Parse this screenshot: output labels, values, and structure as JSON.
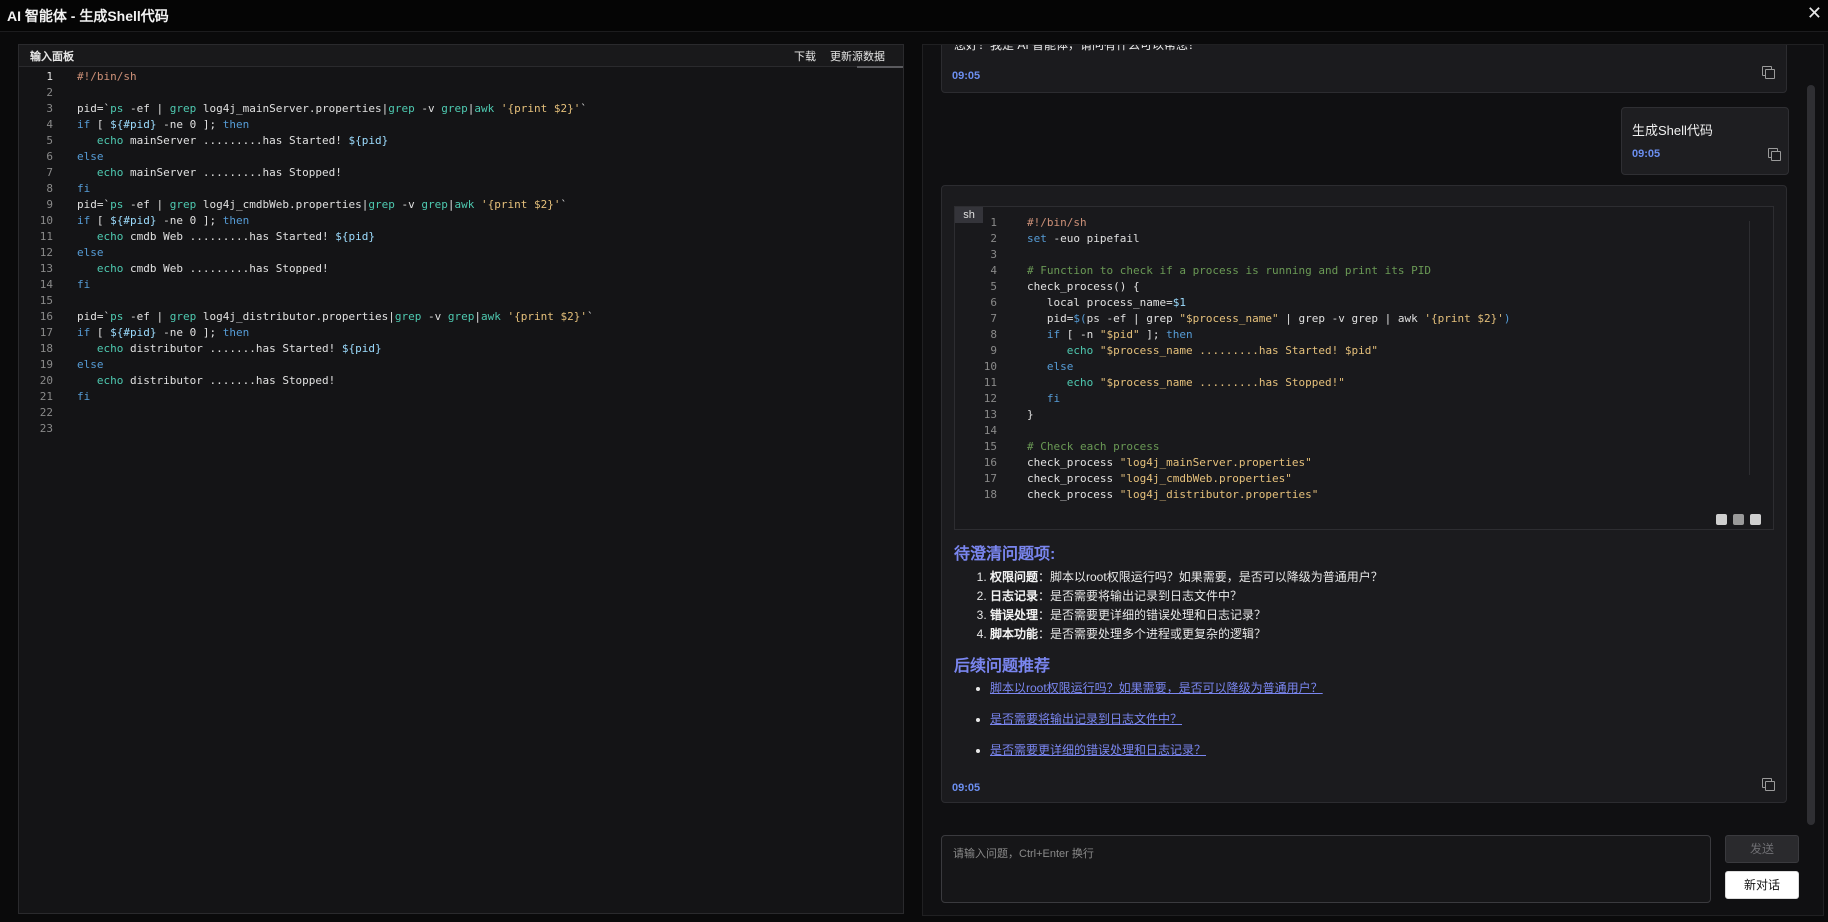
{
  "window": {
    "title": "AI 智能体 - 生成Shell代码",
    "close": "✕"
  },
  "left": {
    "panel_label": "输入面板",
    "download_label": "下载",
    "update_label": "更新源数据",
    "lines": [
      {
        "n": "1",
        "html": "<span class='sh'>#!/bin/sh</span>"
      },
      {
        "n": "2",
        "html": ""
      },
      {
        "n": "3",
        "html": "pid=`<span class='cmd'>ps</span> -ef | <span class='cmd'>grep</span> log4j_mainServer.properties|<span class='cmd'>grep</span> -v <span class='cmd'>grep</span>|<span class='cmd'>awk</span> <span class='str'>'{print $2}'</span>`"
      },
      {
        "n": "4",
        "html": "<span class='kw'>if</span> [ <span class='var'>${#pid}</span> -ne 0 ]; <span class='kw'>then</span>"
      },
      {
        "n": "5",
        "html": "   <span class='cmd'>echo</span> mainServer .........has Started! <span class='var'>${pid}</span>"
      },
      {
        "n": "6",
        "html": "<span class='kw'>else</span>"
      },
      {
        "n": "7",
        "html": "   <span class='cmd'>echo</span> mainServer .........has Stopped!"
      },
      {
        "n": "8",
        "html": "<span class='kw'>fi</span>"
      },
      {
        "n": "9",
        "html": "pid=`<span class='cmd'>ps</span> -ef | <span class='cmd'>grep</span> log4j_cmdbWeb.properties|<span class='cmd'>grep</span> -v <span class='cmd'>grep</span>|<span class='cmd'>awk</span> <span class='str'>'{print $2}'</span>`"
      },
      {
        "n": "10",
        "html": "<span class='kw'>if</span> [ <span class='var'>${#pid}</span> -ne 0 ]; <span class='kw'>then</span>"
      },
      {
        "n": "11",
        "html": "   <span class='cmd'>echo</span> cmdb Web .........has Started! <span class='var'>${pid}</span>"
      },
      {
        "n": "12",
        "html": "<span class='kw'>else</span>"
      },
      {
        "n": "13",
        "html": "   <span class='cmd'>echo</span> cmdb Web .........has Stopped!"
      },
      {
        "n": "14",
        "html": "<span class='kw'>fi</span>"
      },
      {
        "n": "15",
        "html": ""
      },
      {
        "n": "16",
        "html": "pid=`<span class='cmd'>ps</span> -ef | <span class='cmd'>grep</span> log4j_distributor.properties|<span class='cmd'>grep</span> -v <span class='cmd'>grep</span>|<span class='cmd'>awk</span> <span class='str'>'{print $2}'</span>`"
      },
      {
        "n": "17",
        "html": "<span class='kw'>if</span> [ <span class='var'>${#pid}</span> -ne 0 ]; <span class='kw'>then</span>"
      },
      {
        "n": "18",
        "html": "   <span class='cmd'>echo</span> distributor .......has Started! <span class='var'>${pid}</span>"
      },
      {
        "n": "19",
        "html": "<span class='kw'>else</span>"
      },
      {
        "n": "20",
        "html": "   <span class='cmd'>echo</span> distributor .......has Stopped!"
      },
      {
        "n": "21",
        "html": "<span class='kw'>fi</span>"
      },
      {
        "n": "22",
        "html": ""
      },
      {
        "n": "23",
        "html": ""
      }
    ]
  },
  "chat": {
    "greeting": "您好！我是 AI 智能体，请问有什么可以帮您？",
    "greeting_time": "09:05",
    "user_msg": "生成Shell代码",
    "user_time": "09:05",
    "code_lang": "sh",
    "code_lines": [
      {
        "n": "1",
        "html": "<span class='sh'>#!/bin/sh</span>"
      },
      {
        "n": "2",
        "html": "<span class='kw'>set</span> -euo pipefail"
      },
      {
        "n": "3",
        "html": ""
      },
      {
        "n": "4",
        "html": "<span class='cmt'># Function to check if a process is running and print its PID</span>"
      },
      {
        "n": "5",
        "html": "check_process() {"
      },
      {
        "n": "6",
        "html": "   local process_name=<span class='var'>$1</span>"
      },
      {
        "n": "7",
        "html": "   pid=<span class='kw'>$(</span>ps -ef | grep <span class='str'>\"$process_name\"</span> | grep -v grep | awk <span class='str'>'{print $2}'</span><span class='kw'>)</span>"
      },
      {
        "n": "8",
        "html": "   <span class='kw'>if</span> [ -n <span class='str'>\"$pid\"</span> ]; <span class='kw'>then</span>"
      },
      {
        "n": "9",
        "html": "      <span class='cmd'>echo</span> <span class='str'>\"$process_name .........has Started! $pid\"</span>"
      },
      {
        "n": "10",
        "html": "   <span class='kw'>else</span>"
      },
      {
        "n": "11",
        "html": "      <span class='cmd'>echo</span> <span class='str'>\"$process_name .........has Stopped!\"</span>"
      },
      {
        "n": "12",
        "html": "   <span class='kw'>fi</span>"
      },
      {
        "n": "13",
        "html": "}"
      },
      {
        "n": "14",
        "html": ""
      },
      {
        "n": "15",
        "html": "<span class='cmt'># Check each process</span>"
      },
      {
        "n": "16",
        "html": "check_process <span class='str'>\"log4j_mainServer.properties\"</span>"
      },
      {
        "n": "17",
        "html": "check_process <span class='str'>\"log4j_cmdbWeb.properties\"</span>"
      },
      {
        "n": "18",
        "html": "check_process <span class='str'>\"log4j_distributor.properties\"</span>"
      }
    ],
    "clarify_title": "待澄清问题项:",
    "clarify_items": [
      {
        "bold": "权限问题",
        "text": "：脚本以root权限运行吗？如果需要，是否可以降级为普通用户？"
      },
      {
        "bold": "日志记录",
        "text": "：是否需要将输出记录到日志文件中？"
      },
      {
        "bold": "错误处理",
        "text": "：是否需要更详细的错误处理和日志记录？"
      },
      {
        "bold": "脚本功能",
        "text": "：是否需要处理多个进程或更复杂的逻辑？"
      }
    ],
    "followup_title": "后续问题推荐",
    "followups": [
      "脚本以root权限运行吗？如果需要，是否可以降级为普通用户？",
      "是否需要将输出记录到日志文件中？",
      "是否需要更详细的错误处理和日志记录？"
    ],
    "ai_time": "09:05",
    "input_placeholder": "请输入问题，Ctrl+Enter 换行",
    "send_label": "发送",
    "new_chat_label": "新对话"
  }
}
